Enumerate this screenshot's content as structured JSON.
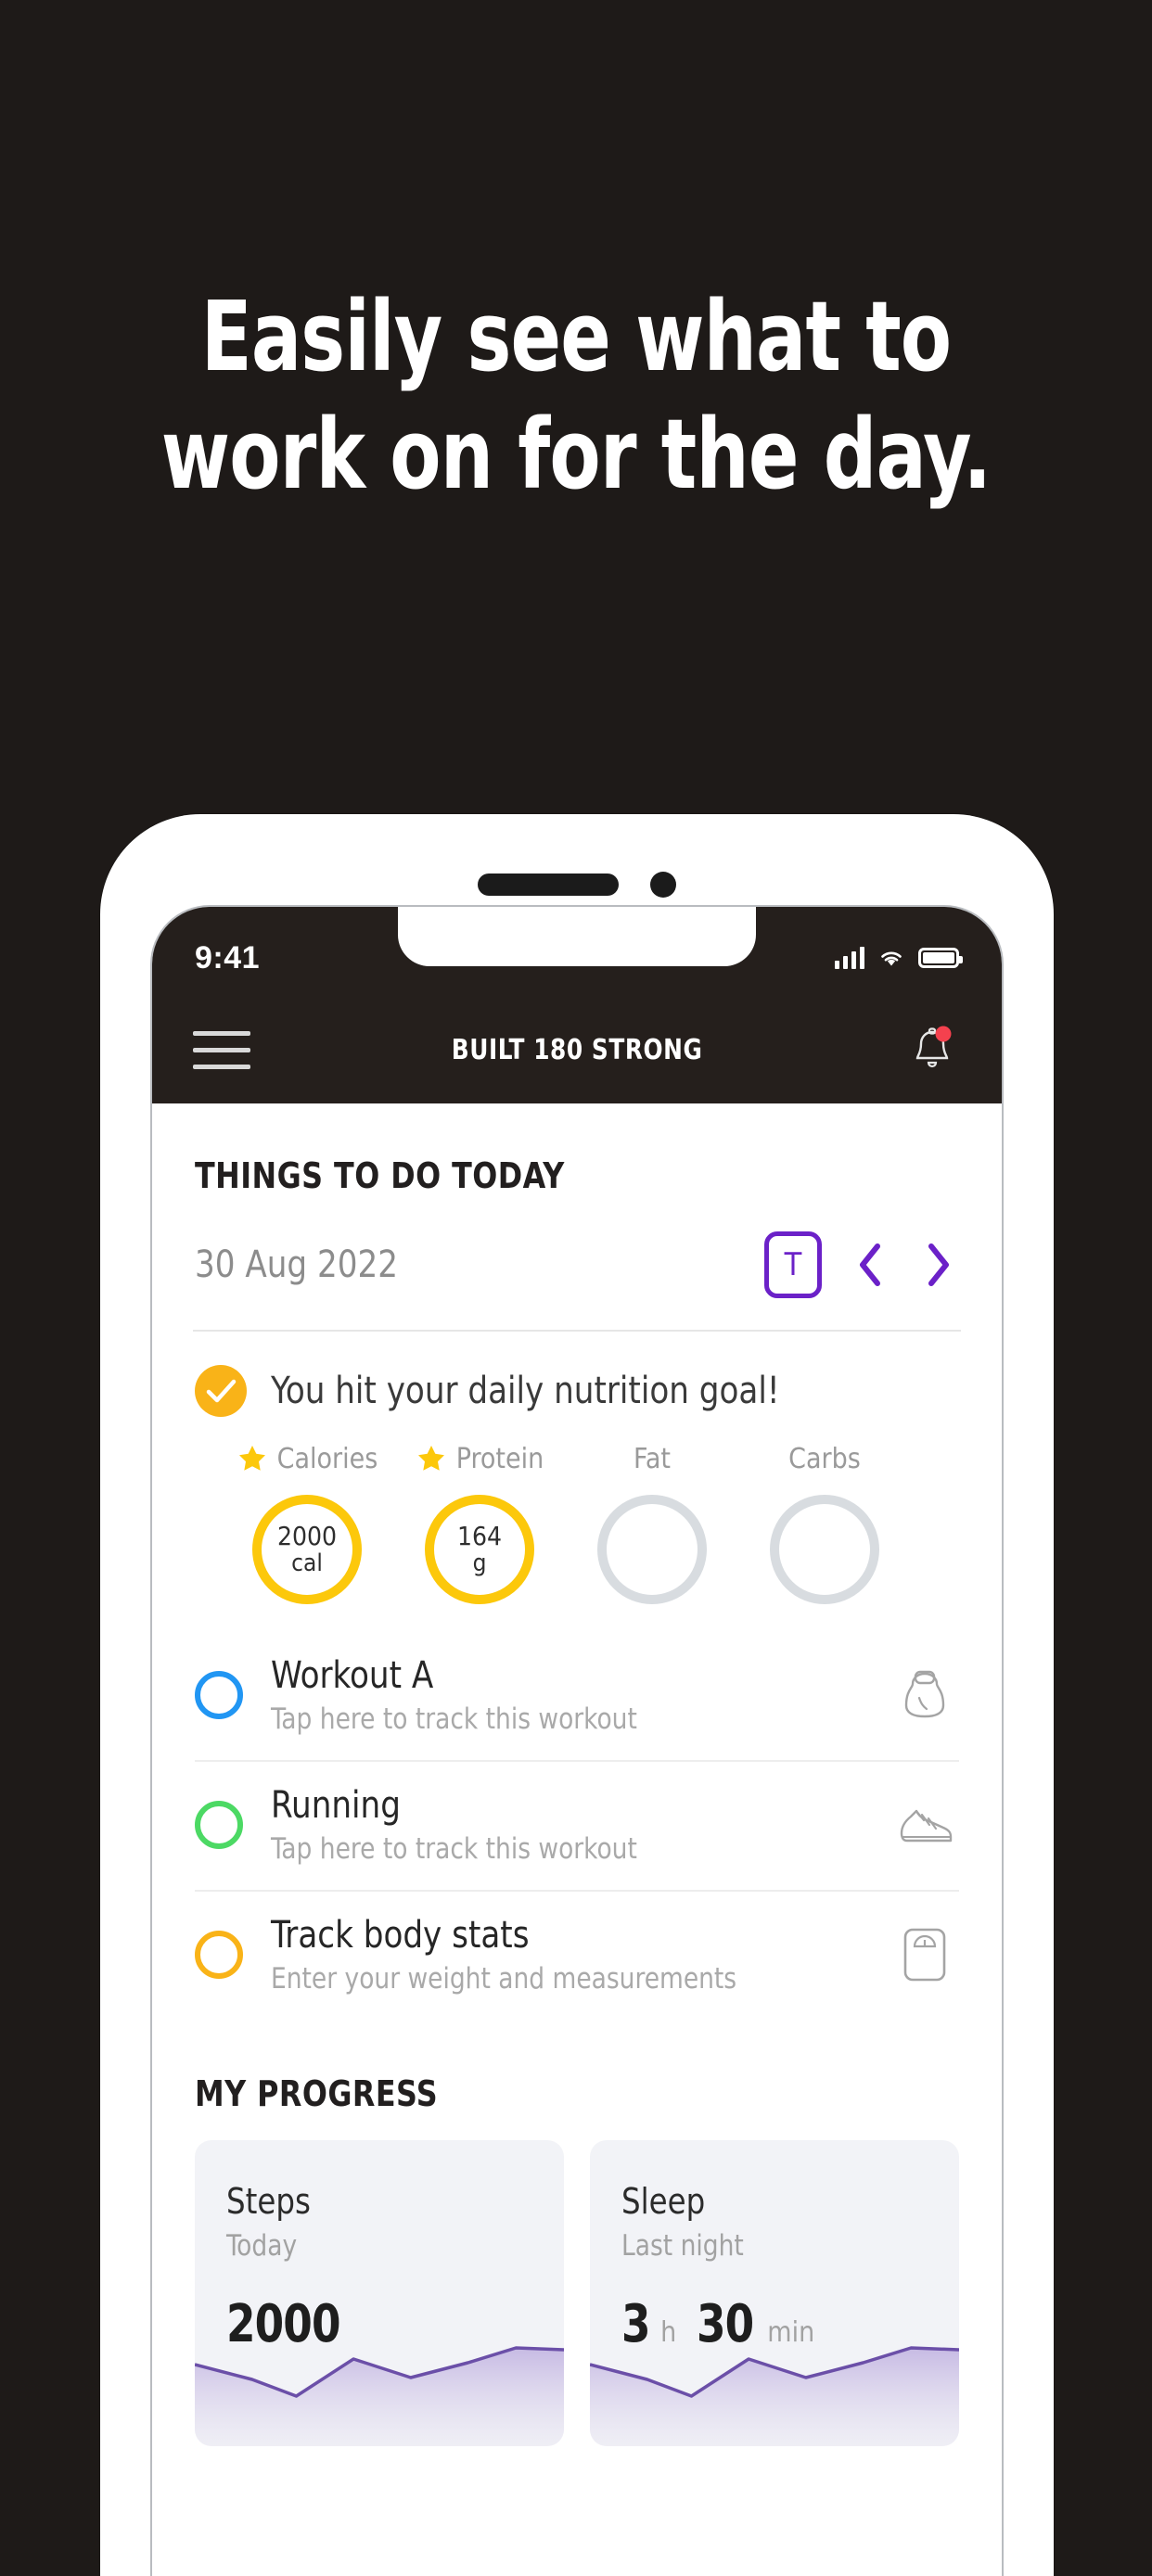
{
  "marketing": {
    "headline_line1": "Easily see what to",
    "headline_line2": "work on for the day."
  },
  "status_bar": {
    "time": "9:41",
    "signal_icon": "cellular-bars-icon",
    "wifi_icon": "wifi-icon",
    "battery_icon": "battery-icon"
  },
  "app_bar": {
    "menu_icon": "hamburger-menu-icon",
    "title": "BUILT 180 STRONG",
    "bell_icon": "bell-icon",
    "has_notification": true
  },
  "todo": {
    "section_title": "THINGS TO DO TODAY",
    "date": "30 Aug 2022",
    "today_button_label": "T",
    "prev_icon": "chevron-left-icon",
    "next_icon": "chevron-right-icon"
  },
  "nutrition": {
    "goal_message": "You hit your daily nutrition goal!",
    "check_icon": "check-circle-icon",
    "macros": [
      {
        "label": "Calories",
        "value": "2000",
        "unit": "cal",
        "starred": true,
        "filled": true
      },
      {
        "label": "Protein",
        "value": "164",
        "unit": "g",
        "starred": true,
        "filled": true
      },
      {
        "label": "Fat",
        "value": "",
        "unit": "",
        "starred": false,
        "filled": false
      },
      {
        "label": "Carbs",
        "value": "",
        "unit": "",
        "starred": false,
        "filled": false
      }
    ]
  },
  "tasks": [
    {
      "title": "Workout A",
      "subtitle": "Tap here to track this workout",
      "circle_color": "#2196F3",
      "icon": "kettlebell-icon"
    },
    {
      "title": "Running",
      "subtitle": "Tap here to track this workout",
      "circle_color": "#4CD964",
      "icon": "sneaker-icon"
    },
    {
      "title": "Track body stats",
      "subtitle": "Enter your weight and measurements",
      "circle_color": "#F9B318",
      "icon": "scale-icon"
    }
  ],
  "progress": {
    "section_title": "MY PROGRESS",
    "cards": [
      {
        "title": "Steps",
        "subtitle": "Today",
        "value": "2000",
        "unit": "",
        "value2": "",
        "unit2": ""
      },
      {
        "title": "Sleep",
        "subtitle": "Last night",
        "value": "3",
        "unit": "h",
        "value2": "30",
        "unit2": "min"
      }
    ]
  },
  "colors": {
    "background": "#1E1A18",
    "accent_purple": "#6B21C8",
    "accent_yellow": "#FCC80B",
    "accent_orange": "#F9B318",
    "ring_empty": "#D8DCE0",
    "notification_red": "#F4414E"
  }
}
